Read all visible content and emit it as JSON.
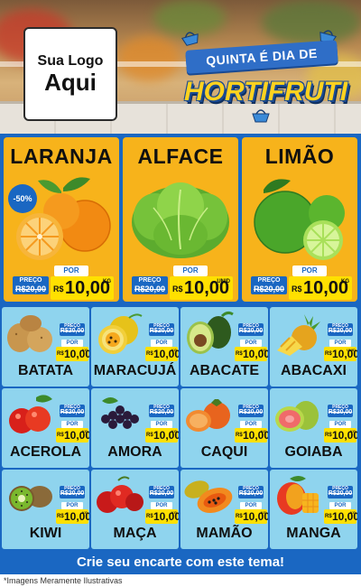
{
  "header": {
    "logo_line1": "Sua Logo",
    "logo_line2": "Aqui",
    "title_line1": "QUINTA É DIA DE",
    "title_line2": "HORTIFRUTI"
  },
  "colors": {
    "brand_blue": "#1a67c2",
    "featured_bg": "#f7b31b",
    "cell_bg": "#8fd4ee",
    "price_yellow": "#ffe000"
  },
  "featured": [
    {
      "name": "LARANJA",
      "badge": "-50%",
      "preco_label": "PREÇO",
      "old_price": "R$20,00",
      "por_label": "POR",
      "currency": "R$",
      "price": "10,00",
      "unit": "KG",
      "icon": "orange-icon"
    },
    {
      "name": "ALFACE",
      "preco_label": "PREÇO",
      "old_price": "R$20,00",
      "por_label": "POR",
      "currency": "R$",
      "price": "10,00",
      "unit": "UNID",
      "icon": "lettuce-icon"
    },
    {
      "name": "LIMÃO",
      "preco_label": "PREÇO",
      "old_price": "R$20,00",
      "por_label": "POR",
      "currency": "R$",
      "price": "10,00",
      "unit": "KG",
      "icon": "lime-icon"
    }
  ],
  "products": [
    {
      "name": "BATATA",
      "preco_label": "PREÇO",
      "old_price": "R$20,00",
      "por_label": "POR",
      "currency": "R$",
      "price": "10,00",
      "unit": "KG",
      "icon": "potato-icon"
    },
    {
      "name": "MARACUJÁ",
      "preco_label": "PREÇO",
      "old_price": "R$20,00",
      "por_label": "POR",
      "currency": "R$",
      "price": "10,00",
      "unit": "KG",
      "icon": "passion-fruit-icon"
    },
    {
      "name": "ABACATE",
      "preco_label": "PREÇO",
      "old_price": "R$20,00",
      "por_label": "POR",
      "currency": "R$",
      "price": "10,00",
      "unit": "KG",
      "icon": "avocado-icon"
    },
    {
      "name": "ABACAXI",
      "preco_label": "PREÇO",
      "old_price": "R$20,00",
      "por_label": "POR",
      "currency": "R$",
      "price": "10,00",
      "unit": "UNID",
      "icon": "pineapple-icon"
    },
    {
      "name": "ACEROLA",
      "preco_label": "PREÇO",
      "old_price": "R$20,00",
      "por_label": "POR",
      "currency": "R$",
      "price": "10,00",
      "unit": "KG",
      "icon": "acerola-icon"
    },
    {
      "name": "AMORA",
      "preco_label": "PREÇO",
      "old_price": "R$20,00",
      "por_label": "POR",
      "currency": "R$",
      "price": "10,00",
      "unit": "KG",
      "icon": "blackberry-icon"
    },
    {
      "name": "CAQUI",
      "preco_label": "PREÇO",
      "old_price": "R$20,00",
      "por_label": "POR",
      "currency": "R$",
      "price": "10,00",
      "unit": "KG",
      "icon": "persimmon-icon"
    },
    {
      "name": "GOIABA",
      "preco_label": "PREÇO",
      "old_price": "R$20,00",
      "por_label": "POR",
      "currency": "R$",
      "price": "10,00",
      "unit": "KG",
      "icon": "guava-icon"
    },
    {
      "name": "KIWI",
      "preco_label": "PREÇO",
      "old_price": "R$20,00",
      "por_label": "POR",
      "currency": "R$",
      "price": "10,00",
      "unit": "KG",
      "icon": "kiwi-icon"
    },
    {
      "name": "MAÇA",
      "preco_label": "PREÇO",
      "old_price": "R$20,00",
      "por_label": "POR",
      "currency": "R$",
      "price": "10,00",
      "unit": "KG",
      "icon": "apple-icon"
    },
    {
      "name": "MAMÃO",
      "preco_label": "PREÇO",
      "old_price": "R$20,00",
      "por_label": "POR",
      "currency": "R$",
      "price": "10,00",
      "unit": "KG",
      "icon": "papaya-icon"
    },
    {
      "name": "MANGA",
      "preco_label": "PREÇO",
      "old_price": "R$20,00",
      "por_label": "POR",
      "currency": "R$",
      "price": "10,00",
      "unit": "KG",
      "icon": "mango-icon"
    }
  ],
  "footer": {
    "cta": "Crie seu encarte com este tema!",
    "disclaimer": "*Imagens Meramente Ilustrativas"
  }
}
